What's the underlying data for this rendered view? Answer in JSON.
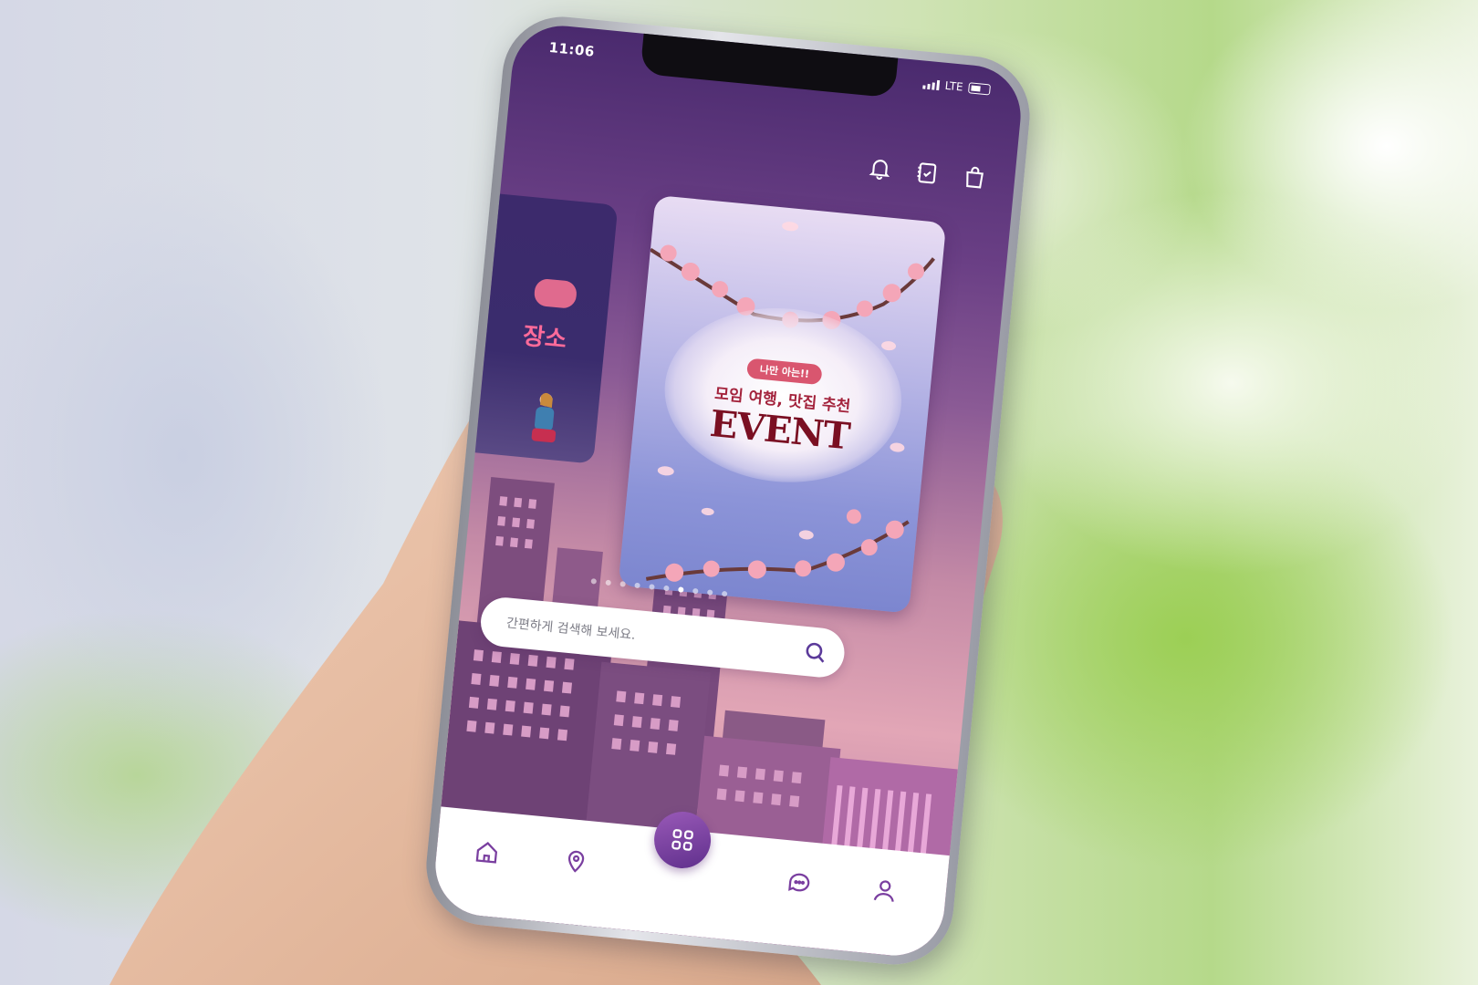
{
  "status_bar": {
    "time": "11:06",
    "network": "LTE"
  },
  "top_actions": {
    "icons": [
      "bell-icon",
      "diary-icon",
      "shopping-bag-icon"
    ]
  },
  "banner": {
    "left_card": {
      "badge_lines": [
        "",
        ""
      ],
      "partial_word": "장소"
    },
    "main_card": {
      "badge": "나만 아는!!",
      "subtitle": "모임 여행, 맛집 추천",
      "title": "EVENT"
    },
    "pagination": {
      "total": 10,
      "active_index": 6
    }
  },
  "search": {
    "placeholder": "간편하게 검색해 보세요."
  },
  "bottom_nav": {
    "items": [
      "home-icon",
      "location-pin-icon",
      "menu-grid-icon",
      "chat-icon",
      "profile-icon"
    ]
  },
  "colors": {
    "accent": "#6a3f85",
    "event_red": "#7a0f22",
    "badge_pink": "#d9566f",
    "nav_active": "#7a3fa0"
  }
}
